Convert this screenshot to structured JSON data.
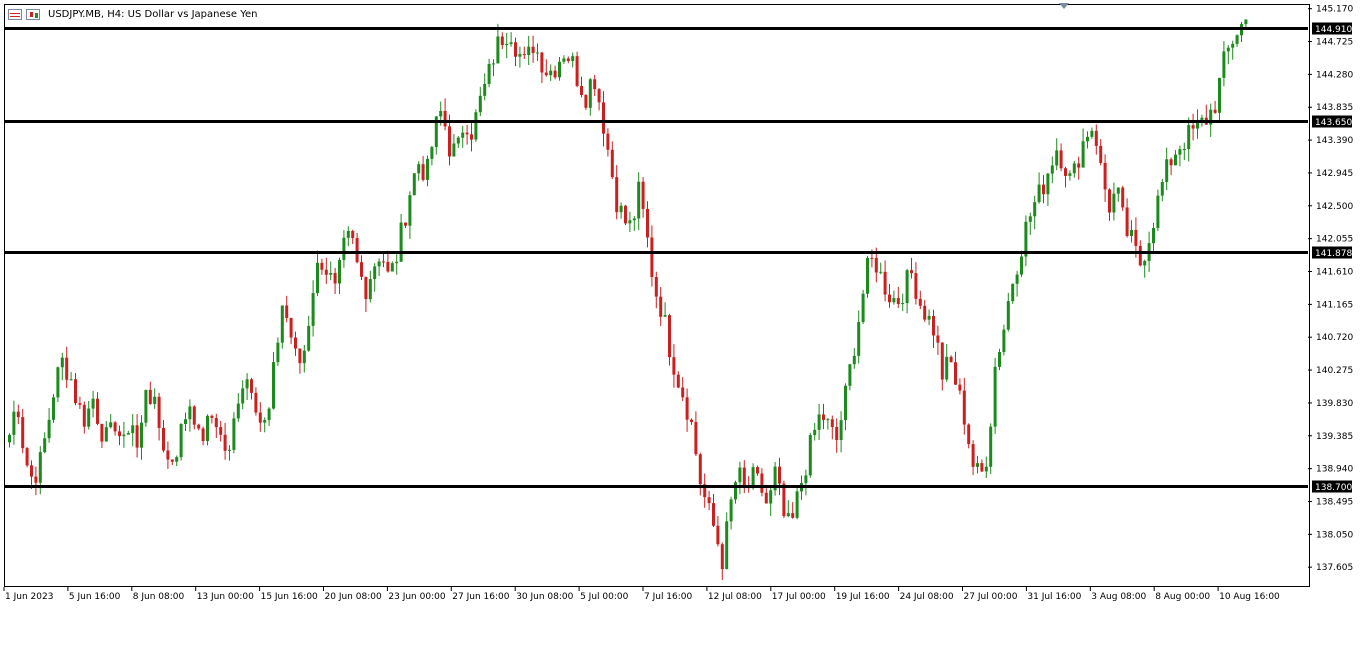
{
  "header": {
    "title": "USDJPY.MB, H4:  US Dollar vs Japanese Yen",
    "icons": [
      "table-icon",
      "candles-icon"
    ]
  },
  "chart_data": {
    "type": "candlestick",
    "symbol": "USDJPY.MB",
    "timeframe": "H4",
    "title": "USDJPY.MB, H4:  US Dollar vs Japanese Yen",
    "ylim": [
      137.35,
      145.22
    ],
    "y_ticks": [
      "145.170",
      "144.725",
      "144.280",
      "143.835",
      "143.390",
      "142.945",
      "142.500",
      "142.055",
      "141.610",
      "141.165",
      "140.720",
      "140.275",
      "139.830",
      "139.385",
      "138.940",
      "138.495",
      "138.050",
      "137.605"
    ],
    "x_ticks": [
      "1 Jun 2023",
      "5 Jun 16:00",
      "8 Jun 08:00",
      "13 Jun 00:00",
      "15 Jun 16:00",
      "20 Jun 08:00",
      "23 Jun 00:00",
      "27 Jun 16:00",
      "30 Jun 08:00",
      "5 Jul 00:00",
      "7 Jul 16:00",
      "12 Jul 08:00",
      "17 Jul 00:00",
      "19 Jul 16:00",
      "24 Jul 08:00",
      "27 Jul 00:00",
      "31 Jul 16:00",
      "3 Aug 08:00",
      "8 Aug 00:00",
      "10 Aug 16:00"
    ],
    "horizontal_levels": [
      {
        "value": 144.91,
        "label": "144.910"
      },
      {
        "value": 143.65,
        "label": "143.650"
      },
      {
        "value": 141.878,
        "label": "141.878"
      },
      {
        "value": 138.7,
        "label": "138.700"
      }
    ],
    "close_path": [
      139.4,
      139.9,
      139.1,
      138.8,
      139.0,
      139.5,
      140.1,
      140.4,
      140.2,
      139.8,
      139.6,
      139.9,
      139.5,
      139.3,
      139.6,
      139.2,
      139.7,
      139.1,
      140.1,
      139.8,
      139.4,
      139.0,
      139.2,
      139.6,
      139.9,
      139.3,
      139.5,
      139.7,
      139.3,
      139.1,
      139.9,
      140.2,
      140.1,
      139.6,
      139.5,
      140.4,
      141.2,
      140.8,
      140.3,
      140.6,
      141.4,
      141.8,
      141.6,
      141.3,
      141.9,
      142.1,
      141.6,
      141.4,
      141.7,
      141.9,
      141.5,
      141.8,
      142.3,
      142.8,
      143.1,
      142.9,
      143.5,
      143.8,
      143.3,
      143.2,
      143.7,
      143.5,
      143.9,
      144.2,
      144.6,
      144.8,
      144.9,
      144.6,
      144.4,
      144.7,
      144.5,
      144.3,
      144.4,
      144.6,
      144.5,
      144.2,
      144.0,
      144.3,
      143.8,
      143.2,
      142.6,
      142.3,
      142.2,
      142.7,
      142.1,
      141.4,
      141.1,
      140.6,
      140.2,
      139.9,
      139.5,
      138.8,
      138.4,
      138.1,
      137.7,
      138.4,
      138.9,
      138.6,
      138.8,
      138.7,
      138.4,
      138.9,
      138.3,
      138.1,
      138.6,
      139.0,
      139.4,
      139.7,
      139.5,
      139.3,
      139.8,
      140.4,
      141.0,
      141.6,
      141.8,
      141.5,
      141.3,
      141.2,
      141.4,
      141.6,
      141.2,
      141.0,
      140.8,
      140.2,
      140.4,
      140.0,
      139.6,
      139.0,
      138.8,
      139.2,
      140.4,
      140.8,
      141.4,
      141.8,
      142.2,
      142.5,
      142.7,
      143.0,
      143.3,
      143.1,
      142.8,
      143.2,
      143.5,
      143.6,
      142.9,
      142.5,
      142.7,
      142.2,
      142.0,
      141.7,
      142.0,
      142.4,
      142.8,
      143.1,
      143.3,
      143.4,
      143.5,
      143.6,
      143.7,
      143.9,
      144.4,
      144.7,
      144.9,
      145.0
    ],
    "grid": false,
    "colors": {
      "bull": "#1c8a1c",
      "bear": "#cc1f1f",
      "level_line": "#000000",
      "label_bg": "#000000",
      "label_text": "#ffffff"
    }
  }
}
